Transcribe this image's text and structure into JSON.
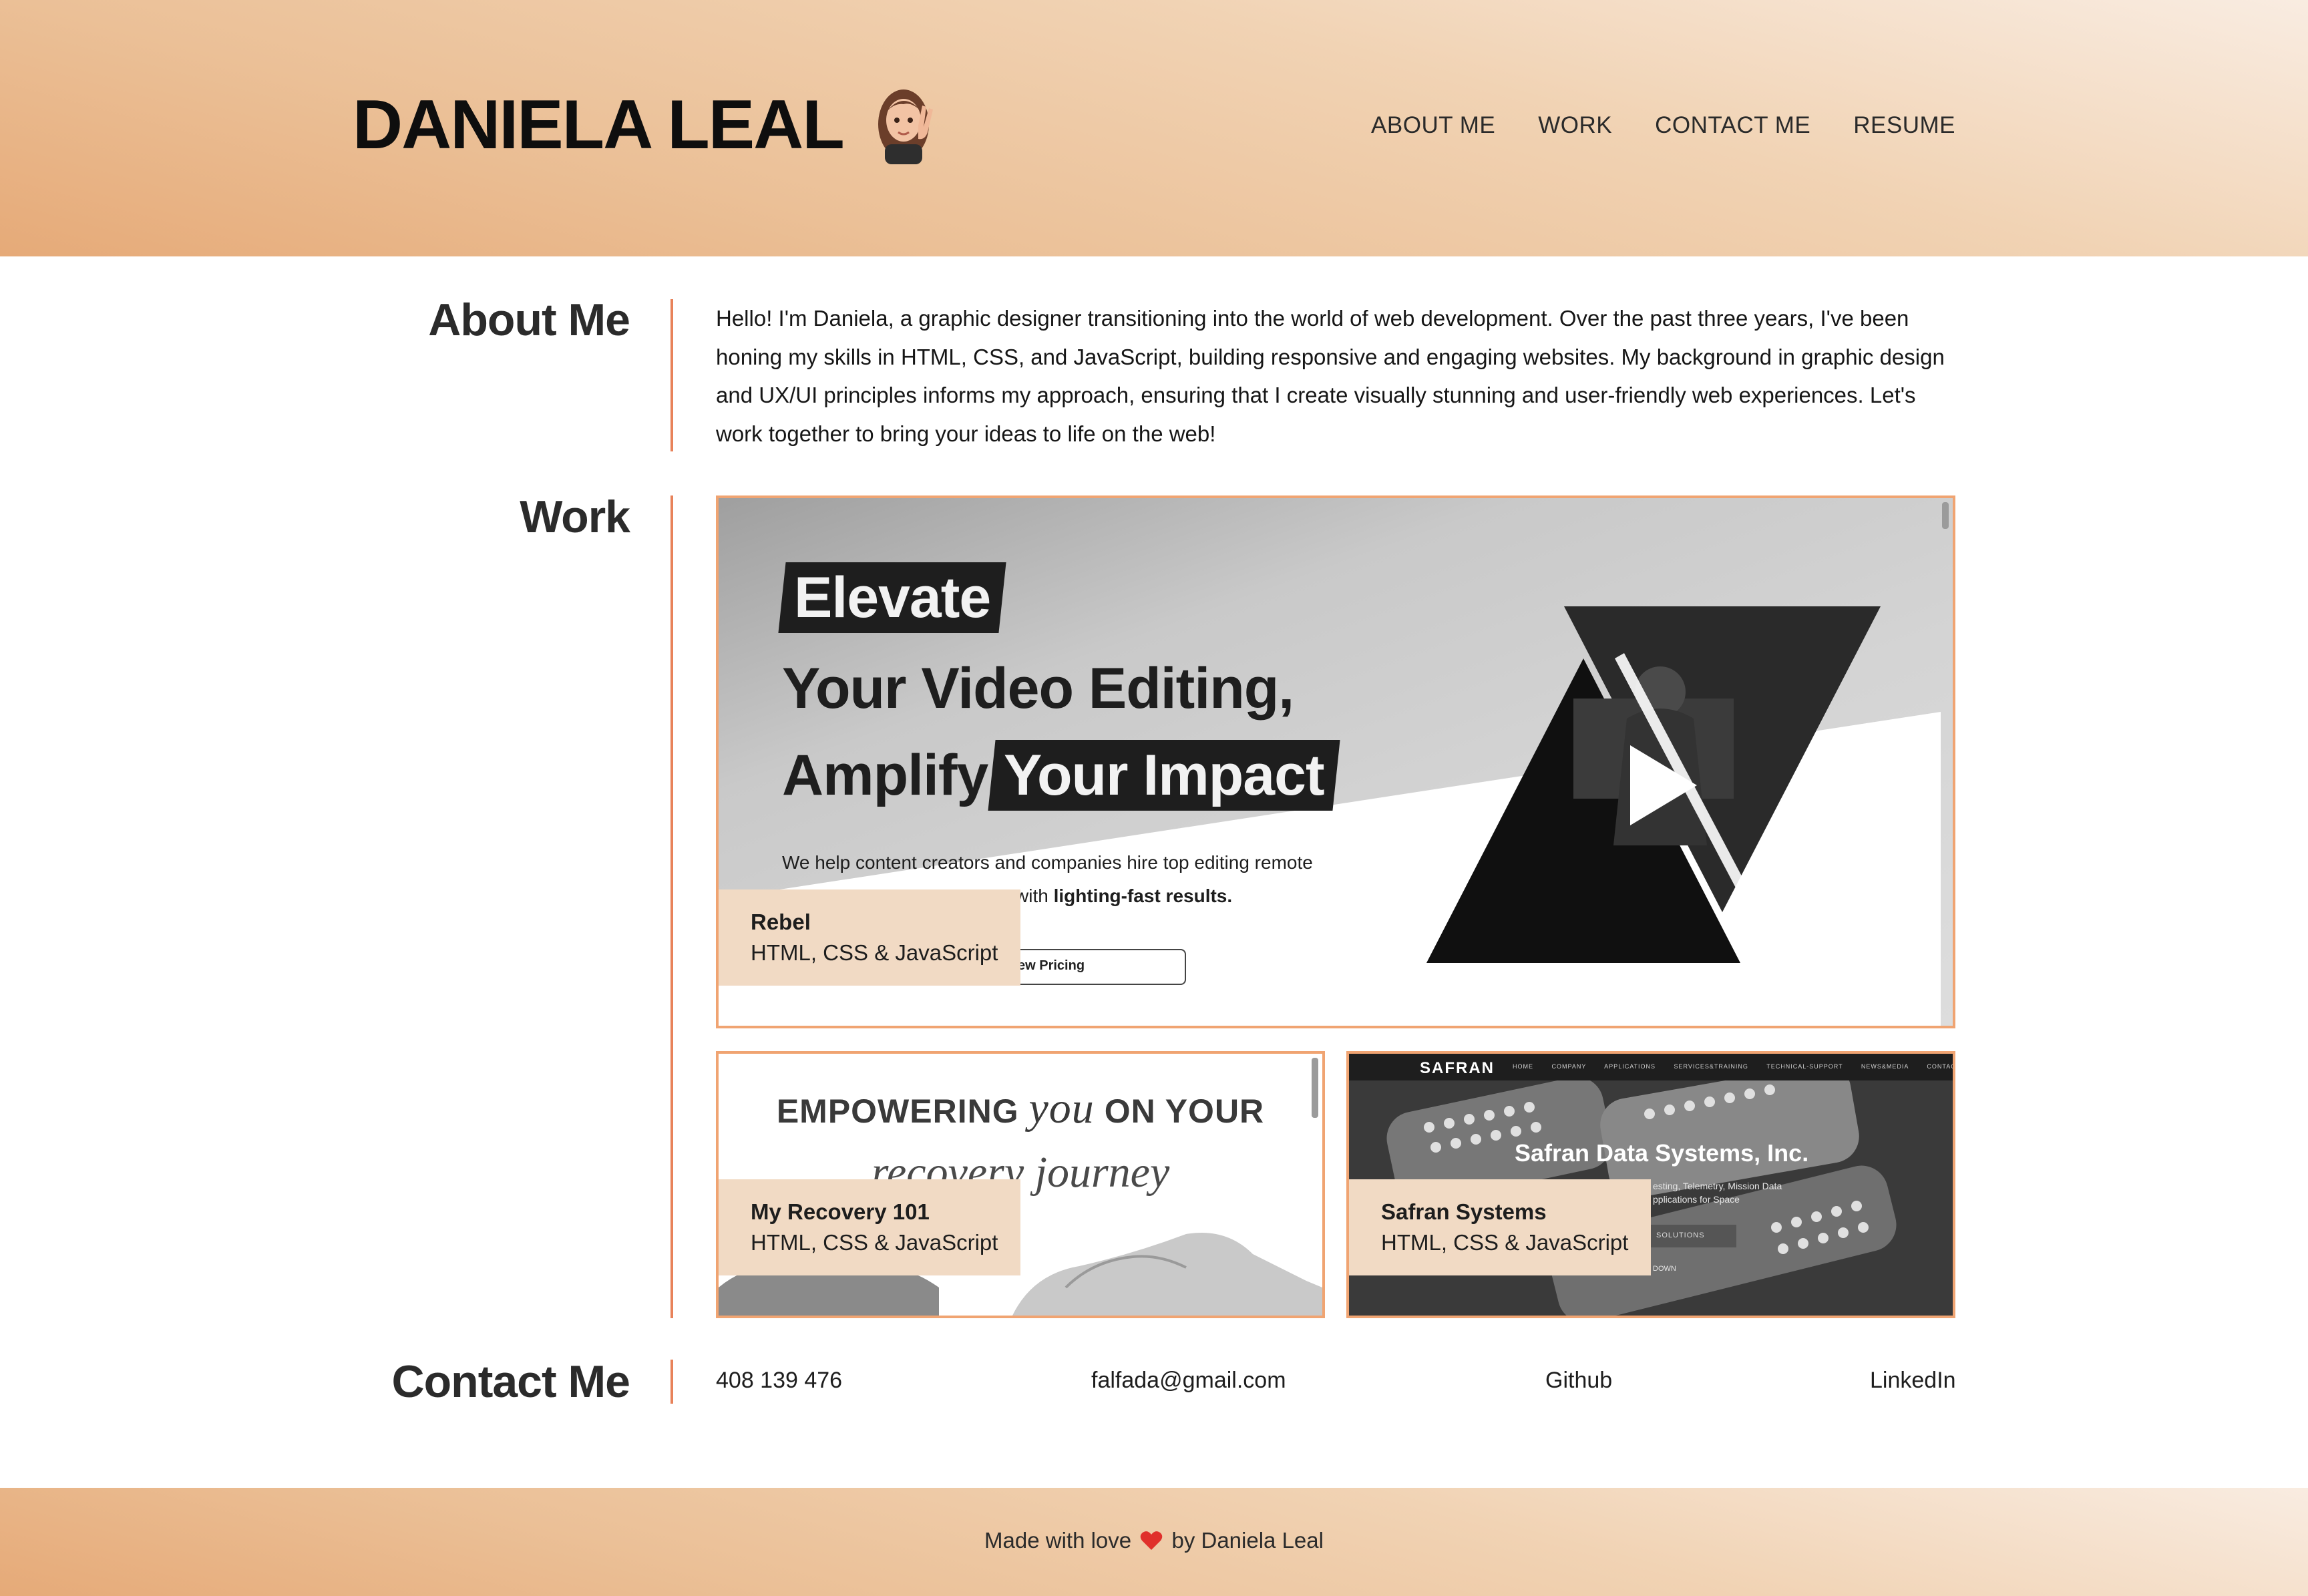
{
  "header": {
    "name": "DANIELA LEAL",
    "avatar_icon": "memoji-peace-sign-icon",
    "nav": [
      {
        "label": "ABOUT ME"
      },
      {
        "label": "WORK"
      },
      {
        "label": "CONTACT ME"
      },
      {
        "label": "RESUME"
      }
    ]
  },
  "about": {
    "title": "About Me",
    "lines": [
      "Hello! I'm Daniela, a graphic designer transitioning into the world of web development. Over the past three years, I've been",
      "honing my skills in HTML, CSS, and JavaScript, building responsive and engaging websites. My background in graphic design",
      "and UX/UI principles informs my approach, ensuring that I create visually stunning and user-friendly web experiences. Let's",
      "work together to bring your ideas to life on the web!"
    ]
  },
  "work": {
    "title": "Work",
    "projects": [
      {
        "name": "Rebel",
        "tech": "HTML, CSS & JavaScript",
        "preview": {
          "line1": "Elevate",
          "line2": "Your Video Editing,",
          "line3a": "Amplify",
          "line3b": "Your Impact",
          "sub1": "We help content creators and companies hire top editing remote",
          "sub2_prefix": "with",
          "sub2_bold": "lighting-fast results.",
          "button": "ew Pricing"
        }
      },
      {
        "name": "My Recovery 101",
        "tech": "HTML, CSS & JavaScript",
        "preview": {
          "title_a": "EMPOWERING",
          "title_b": "you",
          "title_c": "ON YOUR",
          "line2": "recovery journey"
        }
      },
      {
        "name": "Safran Systems",
        "tech": "HTML, CSS & JavaScript",
        "preview": {
          "logo": "SAFRAN",
          "nav_links": "HOME COMPANY APPLICATIONS SERVICES&TRAINING TECHNICAL-SUPPORT NEWS&MEDIA CONTACT-US",
          "hero_title": "Safran Data Systems, Inc.",
          "small1": "esting, Telemetry, Mission Data",
          "small2": "pplications for Space",
          "button": "SOLUTIONS",
          "small3": "DOWN"
        }
      }
    ]
  },
  "contact": {
    "title": "Contact Me",
    "phone": "408 139 476",
    "email": "falfada@gmail.com",
    "github": "Github",
    "linkedin": "LinkedIn"
  },
  "footer": {
    "prefix": "Made with love",
    "suffix": "by Daniela Leal",
    "heart_icon": "red-heart-icon"
  },
  "colors": {
    "accent": "#e8825a",
    "card_border": "#f0a472",
    "caption_bg": "#f1dac4",
    "header_gradient_light": "#f9ece1",
    "header_gradient_dark": "#e6aa78"
  }
}
